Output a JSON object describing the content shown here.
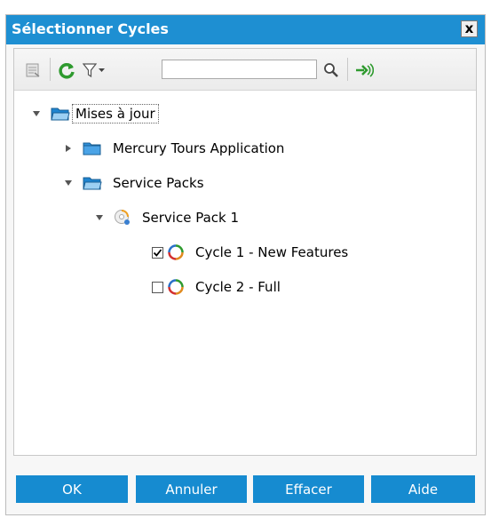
{
  "dialog": {
    "title": "Sélectionner Cycles",
    "close_glyph": "x"
  },
  "toolbar": {
    "search_value": "",
    "icons": [
      "details-icon",
      "refresh-icon",
      "filter-icon",
      "dropdown-arrow-icon",
      "search-icon",
      "go-to-icon"
    ]
  },
  "tree": {
    "root": {
      "label": "Mises à jour",
      "expanded": true
    },
    "mercury": {
      "label": "Mercury Tours Application",
      "expanded": false
    },
    "service_packs": {
      "label": "Service Packs",
      "expanded": true
    },
    "service_pack_1": {
      "label": "Service Pack 1",
      "expanded": true
    },
    "cycle1": {
      "label": "Cycle 1 - New Features",
      "checked": true
    },
    "cycle2": {
      "label": "Cycle 2 - Full",
      "checked": false
    }
  },
  "buttons": {
    "ok": "OK",
    "cancel": "Annuler",
    "clear": "Effacer",
    "help": "Aide"
  },
  "colors": {
    "titlebar": "#1e8fd2",
    "button": "#168bd0",
    "folder_blue": "#2f8fd8"
  }
}
